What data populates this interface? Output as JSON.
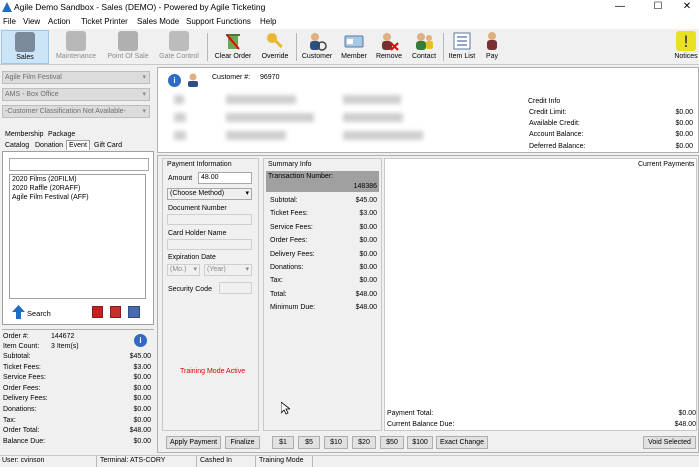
{
  "window": {
    "title": "Agile Demo Sandbox - Sales (DEMO) - Powered by Agile Ticketing",
    "minimize": "—",
    "maximize": "☐",
    "close": "✕"
  },
  "menu": [
    "File",
    "View",
    "Action",
    "Ticket Printer",
    "Sales Mode",
    "Support Functions",
    "Help"
  ],
  "toolbar": {
    "sales": "Sales",
    "maintenance": "Maintenance",
    "point_of_sale": "Point Of Sale",
    "gate_control": "Gate Control",
    "clear_order": "Clear Order",
    "override": "Override",
    "customer": "Customer",
    "member": "Member",
    "remove": "Remove",
    "contact": "Contact",
    "item_list": "Item List",
    "pay": "Pay",
    "notices": "Notices"
  },
  "left": {
    "org": "Agile Film Festival",
    "office": "AMS - Box Office",
    "classification": "-Customer Classification Not Available-",
    "tabs_row1": [
      "Membership",
      "Package"
    ],
    "tabs_row2": [
      "Catalog",
      "Donation",
      "Event",
      "Gift Card"
    ],
    "events": [
      "2020 Films  (20FILM)",
      "2020 Raffle  (20RAFF)",
      "Agile Film Festival  (AFF)"
    ],
    "search": "Search",
    "order": [
      {
        "label": "Order #:",
        "value": "144672"
      },
      {
        "label": "Item Count:",
        "value": "3 Item(s)"
      }
    ],
    "totals": [
      {
        "label": "Subtotal:",
        "value": "$45.00"
      },
      {
        "label": "Ticket Fees:",
        "value": "$3.00"
      },
      {
        "label": "Service Fees:",
        "value": "$0.00"
      },
      {
        "label": "Order Fees:",
        "value": "$0.00"
      },
      {
        "label": "Delivery Fees:",
        "value": "$0.00"
      },
      {
        "label": "Donations:",
        "value": "$0.00"
      },
      {
        "label": "Tax:",
        "value": "$0.00"
      },
      {
        "label": "Order Total:",
        "value": "$48.00"
      },
      {
        "label": "Balance Due:",
        "value": "$0.00"
      }
    ]
  },
  "customer": {
    "label": "Customer #:",
    "number": "96970",
    "credit_title": "Credit Info",
    "credit": [
      {
        "label": "Credit Limit:",
        "value": "$0.00"
      },
      {
        "label": "Available Credit:",
        "value": "$0.00"
      },
      {
        "label": "Account Balance:",
        "value": "$0.00"
      },
      {
        "label": "Deferred Balance:",
        "value": "$0.00"
      }
    ]
  },
  "payment": {
    "title": "Payment Information",
    "amount_label": "Amount",
    "amount_value": "48.00",
    "method": "(Choose Method)",
    "doc_label": "Document Number",
    "holder_label": "Card Holder Name",
    "exp_label": "Expiration Date",
    "exp_month": "(Mo.)",
    "exp_year": "(Year)",
    "security_label": "Security Code",
    "training": "Training Mode Active"
  },
  "summary": {
    "title": "Summary Info",
    "txn_label": "Transaction Number:",
    "txn_value": "148386",
    "rows": [
      {
        "label": "Subtotal:",
        "value": "$45.00"
      },
      {
        "label": "Ticket Fees:",
        "value": "$3.00"
      },
      {
        "label": "Service Fees:",
        "value": "$0.00"
      },
      {
        "label": "Order Fees:",
        "value": "$0.00"
      },
      {
        "label": "Delivery Fees:",
        "value": "$0.00"
      },
      {
        "label": "Donations:",
        "value": "$0.00"
      },
      {
        "label": "Tax:",
        "value": "$0.00"
      },
      {
        "label": "Total:",
        "value": "$48.00"
      },
      {
        "label": "Minimum Due:",
        "value": "$48.00"
      }
    ]
  },
  "current": {
    "title": "Current Payments",
    "payment_total_label": "Payment Total:",
    "payment_total": "$0.00",
    "balance_label": "Current Balance Due:",
    "balance": "$48.00"
  },
  "buttons": [
    "Apply Payment",
    "Finalize",
    "$1",
    "$5",
    "$10",
    "$20",
    "$50",
    "$100",
    "Exact Change"
  ],
  "void": "Void Selected",
  "status": {
    "user": "User:  cvinson",
    "terminal": "Terminal:  ATS-CORY",
    "cashed": "Cashed In",
    "mode": "Training Mode"
  },
  "colors": {
    "accent": "#cce4f7",
    "training": "#e00000",
    "txn_bg": "#a0a0a0"
  }
}
